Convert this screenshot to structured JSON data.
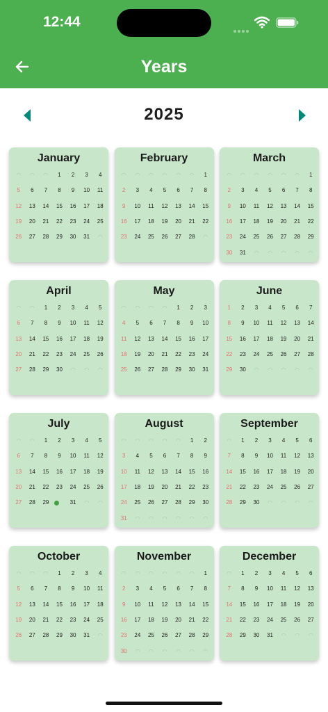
{
  "status_bar": {
    "time": "12:44"
  },
  "header": {
    "title": "Years"
  },
  "year_nav": {
    "year": "2025"
  },
  "today": {
    "month": 6,
    "day": 30
  },
  "months": [
    {
      "name": "January",
      "offset": 3,
      "days": 31
    },
    {
      "name": "February",
      "offset": 6,
      "days": 28
    },
    {
      "name": "March",
      "offset": 6,
      "days": 31
    },
    {
      "name": "April",
      "offset": 2,
      "days": 30
    },
    {
      "name": "May",
      "offset": 4,
      "days": 31
    },
    {
      "name": "June",
      "offset": 0,
      "days": 30
    },
    {
      "name": "July",
      "offset": 2,
      "days": 31
    },
    {
      "name": "August",
      "offset": 5,
      "days": 31
    },
    {
      "name": "September",
      "offset": 1,
      "days": 30
    },
    {
      "name": "October",
      "offset": 3,
      "days": 31
    },
    {
      "name": "November",
      "offset": 6,
      "days": 30
    },
    {
      "name": "December",
      "offset": 1,
      "days": 31
    }
  ],
  "colors": {
    "appbar": "#4caf50",
    "card": "#c8e6c9",
    "sunday_text": "#e57373",
    "today_dot": "#43a047",
    "nav_arrow": "#00897b"
  }
}
